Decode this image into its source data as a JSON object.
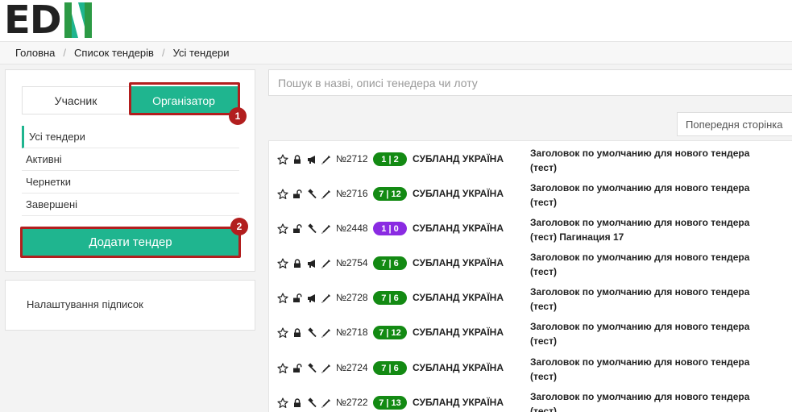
{
  "logo": {
    "text": "ED",
    "n_icon": "N-letter-logo-icon"
  },
  "breadcrumb": {
    "items": [
      "Головна",
      "Список тендерів",
      "Усі тендери"
    ],
    "separator": "/"
  },
  "role_toggle": {
    "participant": "Учасник",
    "organizer": "Організатор",
    "active": "organizer"
  },
  "menu": {
    "items": [
      "Усі тендери",
      "Активні",
      "Чернетки",
      "Завершені"
    ],
    "active_index": 0
  },
  "add_button": "Додати тендер",
  "annotations": [
    "1",
    "2"
  ],
  "settings_link": "Налаштування підписок",
  "search": {
    "placeholder": "Пошук в назві, описі тенедера чи лоту",
    "value": ""
  },
  "prev_page": "Попередня сторінка",
  "colors": {
    "accent": "#1fb58f",
    "highlight": "#b21e1e",
    "badge_green": "#138a13",
    "badge_purple": "#8a2be2"
  },
  "tenders": [
    {
      "id": "№2712",
      "counter": "1 | 2",
      "counter_color": "green",
      "org": "СУБЛАНД УКРАЇНА",
      "title": "Заголовок по умолчанию для нового тендера (тест)",
      "icons": [
        "star-icon",
        "lock-icon",
        "megaphone-icon",
        "pen-icon"
      ]
    },
    {
      "id": "№2716",
      "counter": "7 | 12",
      "counter_color": "green",
      "org": "СУБЛАНД УКРАЇНА",
      "title": "Заголовок по умолчанию для нового тендера (тест)",
      "icons": [
        "star-icon",
        "unlock-icon",
        "gavel-icon",
        "pen-icon"
      ]
    },
    {
      "id": "№2448",
      "counter": "1 | 0",
      "counter_color": "purple",
      "org": "СУБЛАНД УКРАЇНА",
      "title": "Заголовок по умолчанию для нового тендера (тест) Пагинация 17",
      "icons": [
        "star-icon",
        "unlock-icon",
        "gavel-icon",
        "pen-icon"
      ]
    },
    {
      "id": "№2754",
      "counter": "7 | 6",
      "counter_color": "green",
      "org": "СУБЛАНД УКРАЇНА",
      "title": "Заголовок по умолчанию для нового тендера (тест)",
      "icons": [
        "star-icon",
        "lock-icon",
        "megaphone-icon",
        "pen-icon"
      ]
    },
    {
      "id": "№2728",
      "counter": "7 | 6",
      "counter_color": "green",
      "org": "СУБЛАНД УКРАЇНА",
      "title": "Заголовок по умолчанию для нового тендера (тест)",
      "icons": [
        "star-icon",
        "unlock-icon",
        "megaphone-icon",
        "pen-icon"
      ]
    },
    {
      "id": "№2718",
      "counter": "7 | 12",
      "counter_color": "green",
      "org": "СУБЛАНД УКРАЇНА",
      "title": "Заголовок по умолчанию для нового тендера (тест)",
      "icons": [
        "star-icon",
        "lock-icon",
        "gavel-icon",
        "pen-icon"
      ]
    },
    {
      "id": "№2724",
      "counter": "7 | 6",
      "counter_color": "green",
      "org": "СУБЛАНД УКРАЇНА",
      "title": "Заголовок по умолчанию для нового тендера (тест)",
      "icons": [
        "star-icon",
        "unlock-icon",
        "gavel-icon",
        "pen-icon"
      ]
    },
    {
      "id": "№2722",
      "counter": "7 | 13",
      "counter_color": "green",
      "org": "СУБЛАНД УКРАЇНА",
      "title": "Заголовок по умолчанию для нового тендера (тест)",
      "icons": [
        "star-icon",
        "lock-icon",
        "gavel-icon",
        "pen-icon"
      ]
    }
  ]
}
